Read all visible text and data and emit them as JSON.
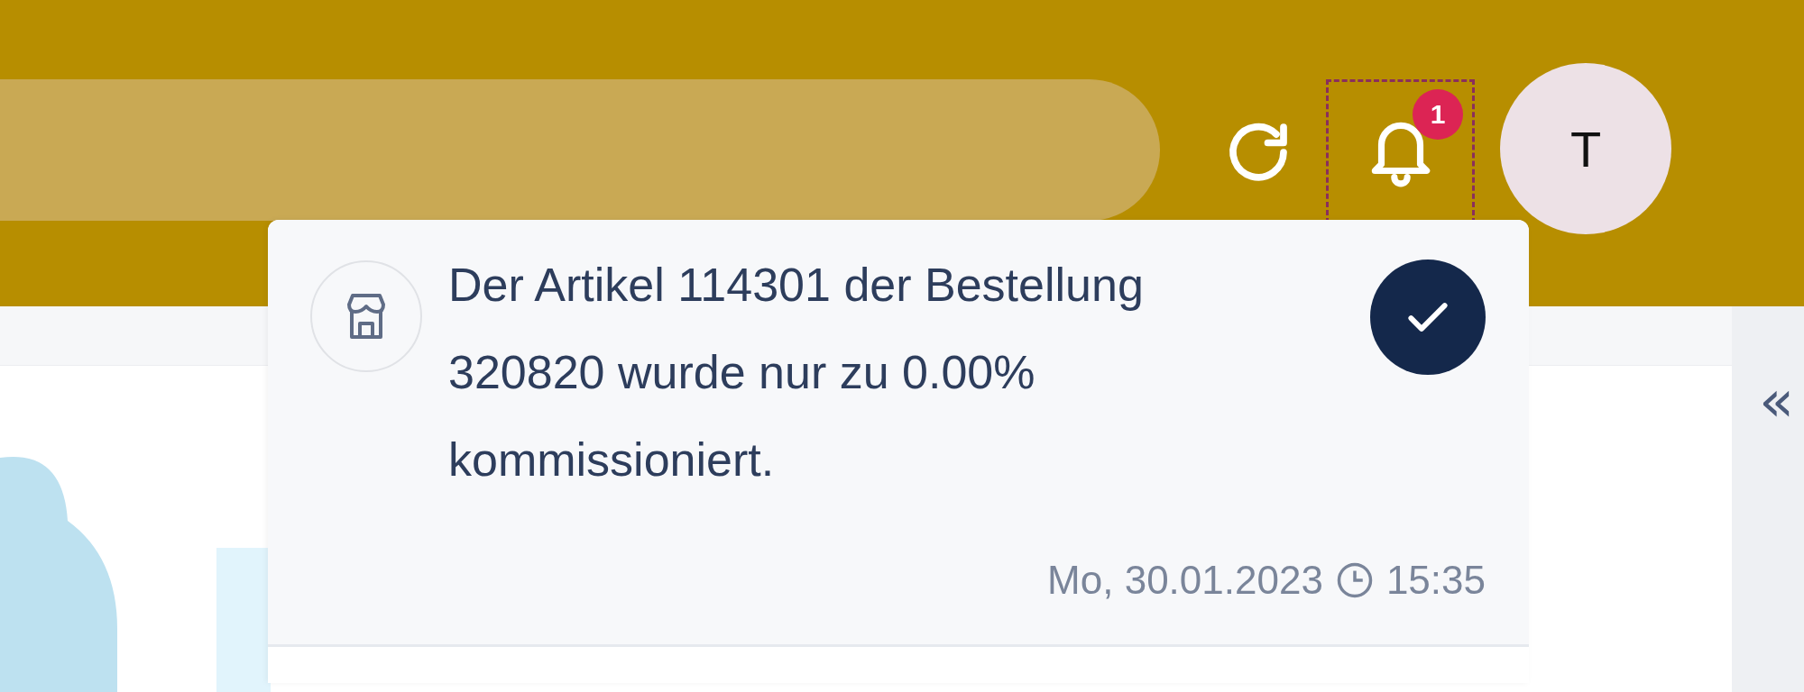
{
  "header": {
    "notification_badge": "1",
    "avatar_initial": "T"
  },
  "notifications": [
    {
      "message": "Der Artikel 114301 der Bestellung 320820 wurde nur zu 0.00% kommissioniert.",
      "date": "Mo, 30.01.2023",
      "time": "15:35"
    }
  ],
  "side_panel": {
    "collapse_glyph": "«"
  }
}
